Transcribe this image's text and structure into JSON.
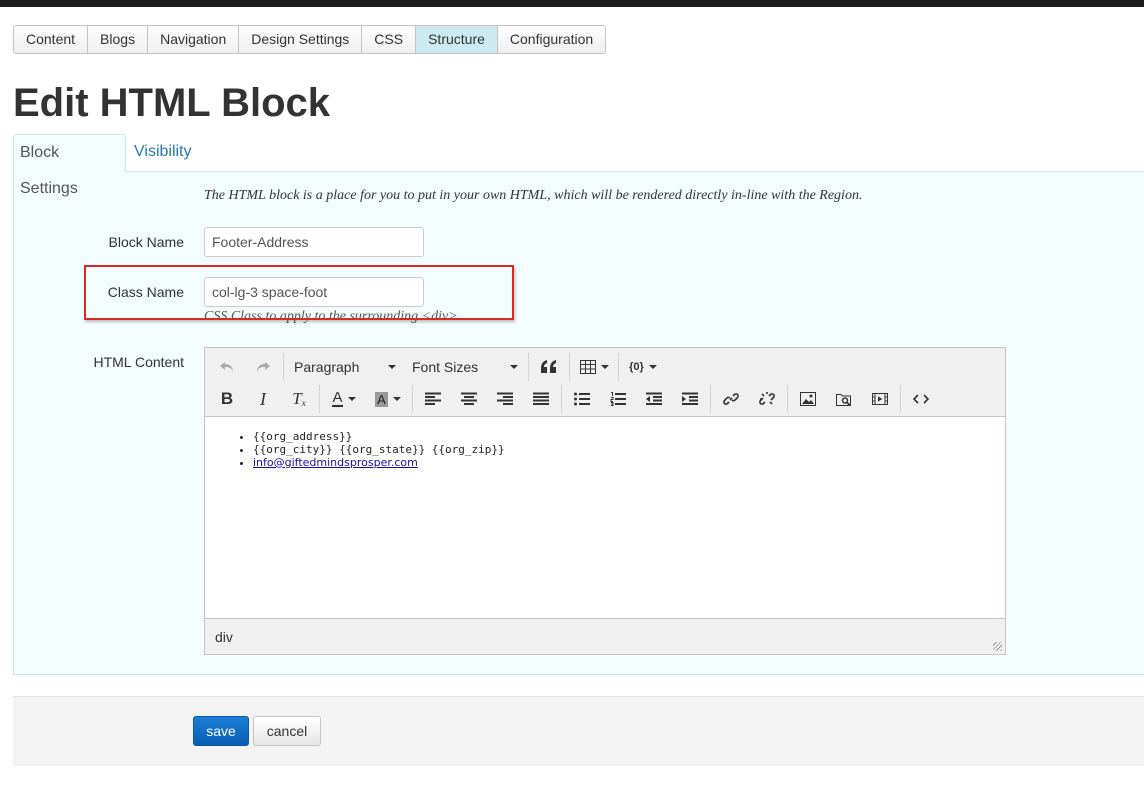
{
  "nav": {
    "items": [
      {
        "label": "Content"
      },
      {
        "label": "Blogs"
      },
      {
        "label": "Navigation"
      },
      {
        "label": "Design Settings"
      },
      {
        "label": "CSS"
      },
      {
        "label": "Structure",
        "active": true
      },
      {
        "label": "Configuration"
      }
    ]
  },
  "page": {
    "title": "Edit HTML Block"
  },
  "tabs": {
    "block_settings": "Block Settings",
    "visibility": "Visibility"
  },
  "form": {
    "intro": "The HTML block is a place for you to put in your own HTML, which will be rendered directly in-line with the Region.",
    "block_name_label": "Block Name",
    "block_name_value": "Footer-Address",
    "class_name_label": "Class Name",
    "class_name_value": "col-lg-3 space-foot",
    "class_name_hint": "CSS Class to apply to the surrounding <div>",
    "html_content_label": "HTML Content"
  },
  "editor": {
    "format_dropdown": "Paragraph",
    "font_size_dropdown": "Font Sizes",
    "content": {
      "items": [
        "{{org_address}}",
        "{{org_city}} {{org_state}} {{org_zip}}"
      ],
      "link": "info@giftedmindsprosper.com"
    },
    "status_path": "div",
    "icons": {
      "undo": "undo-icon",
      "redo": "redo-icon",
      "blockquote": "blockquote-icon",
      "table": "table-icon",
      "variables": "variables-icon",
      "bold": "bold-icon",
      "italic": "italic-icon",
      "clear_format": "clear-format-icon",
      "text_color": "text-color-icon",
      "bg_color": "background-color-icon",
      "align_left": "align-left-icon",
      "align_center": "align-center-icon",
      "align_right": "align-right-icon",
      "justify": "justify-icon",
      "bullet_list": "bullet-list-icon",
      "numbered_list": "numbered-list-icon",
      "outdent": "outdent-icon",
      "indent": "indent-icon",
      "link": "link-icon",
      "unlink": "unlink-icon",
      "image": "image-icon",
      "browse": "browse-files-icon",
      "media": "media-icon",
      "code": "code-icon"
    }
  },
  "actions": {
    "save": "save",
    "cancel": "cancel"
  },
  "colors": {
    "active_nav": "#cdeaf1",
    "panel_bg": "#f4fdfe",
    "link": "#2a7ab0",
    "save_button": "#0a5db5",
    "highlight": "#d62b2b"
  }
}
